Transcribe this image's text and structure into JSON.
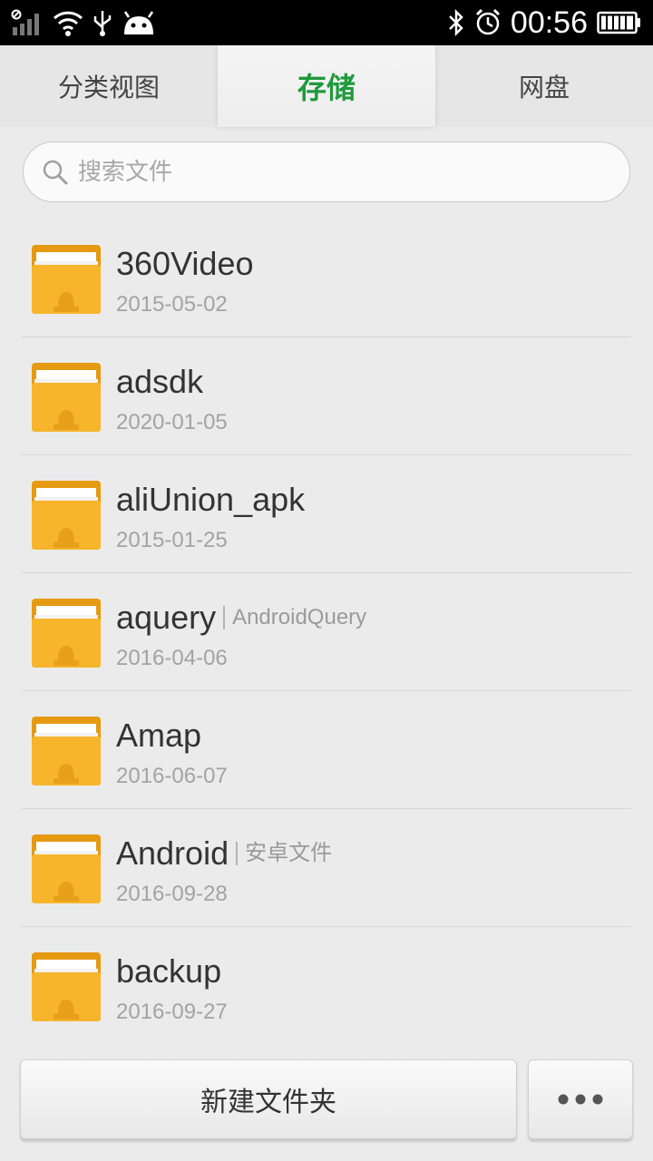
{
  "status_bar": {
    "time": "00:56",
    "icons_left": [
      "blocked-signal-icon",
      "signal-bars-icon",
      "wifi-icon",
      "usb-icon",
      "android-notification-icon"
    ],
    "icons_right": [
      "bluetooth-icon",
      "alarm-icon",
      "battery-icon"
    ]
  },
  "tabs": [
    {
      "label": "分类视图",
      "active": false
    },
    {
      "label": "存储",
      "active": true
    },
    {
      "label": "网盘",
      "active": false
    }
  ],
  "search": {
    "placeholder": "搜索文件",
    "icon": "search-icon"
  },
  "files": [
    {
      "name": "360Video",
      "alias": "",
      "date": "2015-05-02"
    },
    {
      "name": "adsdk",
      "alias": "",
      "date": "2020-01-05"
    },
    {
      "name": "aliUnion_apk",
      "alias": "",
      "date": "2015-01-25"
    },
    {
      "name": "aquery",
      "alias": "AndroidQuery",
      "date": "2016-04-06"
    },
    {
      "name": "Amap",
      "alias": "",
      "date": "2016-06-07"
    },
    {
      "name": "Android",
      "alias": "安卓文件",
      "date": "2016-09-28"
    },
    {
      "name": "backup",
      "alias": "",
      "date": "2016-09-27"
    }
  ],
  "bottom": {
    "new_folder_label": "新建文件夹",
    "more_icon": "more-dots-icon"
  },
  "colors": {
    "accent": "#1f9a3c",
    "folder": "#f5b324"
  }
}
